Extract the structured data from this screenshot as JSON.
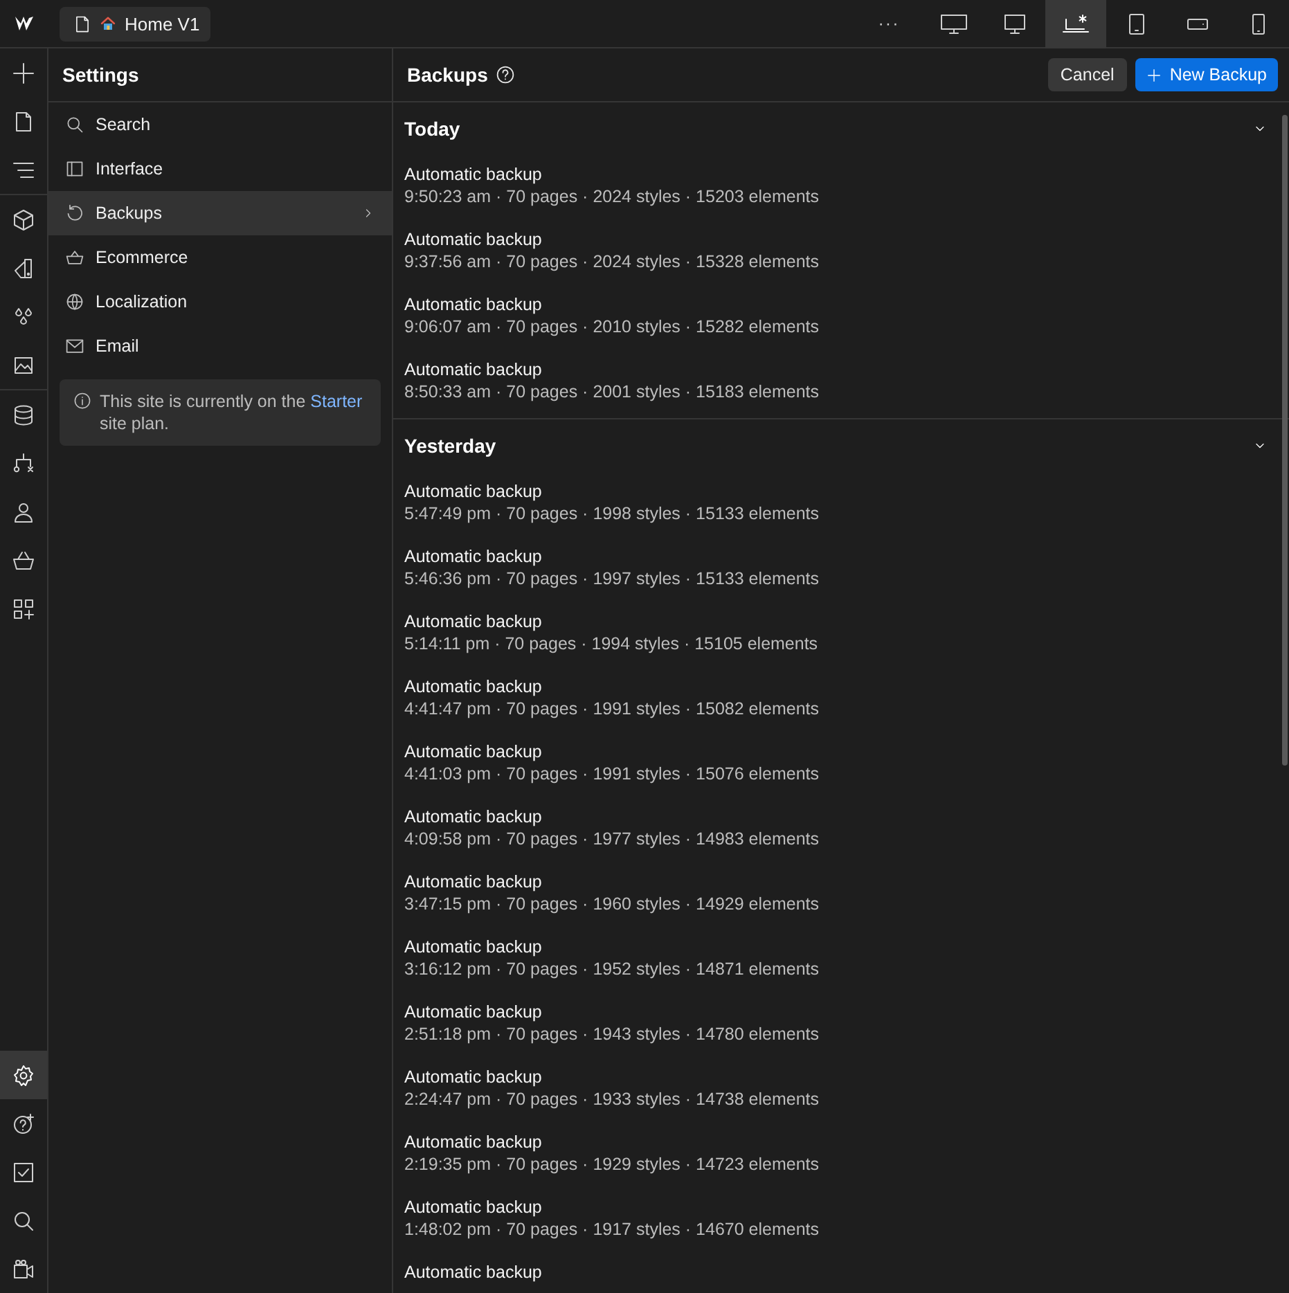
{
  "topbar": {
    "page_button": {
      "label": "Home V1"
    },
    "more": "···",
    "devices": [
      {
        "kind": "desktop-large",
        "selected": false
      },
      {
        "kind": "desktop",
        "selected": false
      },
      {
        "kind": "laptop-star",
        "selected": true
      },
      {
        "kind": "tablet",
        "selected": false
      },
      {
        "kind": "phone-landscape",
        "selected": false
      },
      {
        "kind": "phone",
        "selected": false
      }
    ]
  },
  "rail": {
    "top": [
      {
        "kind": "plus",
        "selected": false
      },
      {
        "kind": "page",
        "selected": false
      },
      {
        "kind": "navigator",
        "selected": false
      },
      {
        "kind": "cube",
        "selected": false
      },
      {
        "kind": "paint",
        "selected": false
      },
      {
        "kind": "drops",
        "selected": false
      },
      {
        "kind": "image",
        "selected": false
      },
      {
        "kind": "database",
        "selected": false
      },
      {
        "kind": "logic",
        "selected": false
      },
      {
        "kind": "user",
        "selected": false
      },
      {
        "kind": "basket",
        "selected": false
      },
      {
        "kind": "apps",
        "selected": false
      }
    ],
    "bottom": [
      {
        "kind": "gear",
        "selected": true
      },
      {
        "kind": "help",
        "selected": false
      },
      {
        "kind": "check",
        "selected": false
      },
      {
        "kind": "search",
        "selected": false
      },
      {
        "kind": "video",
        "selected": false
      }
    ]
  },
  "settings": {
    "title": "Settings",
    "items": [
      {
        "kind": "search",
        "label": "Search",
        "selected": false
      },
      {
        "kind": "interface",
        "label": "Interface",
        "selected": false
      },
      {
        "kind": "backups",
        "label": "Backups",
        "selected": true
      },
      {
        "kind": "ecommerce",
        "label": "Ecommerce",
        "selected": false
      },
      {
        "kind": "localization",
        "label": "Localization",
        "selected": false
      },
      {
        "kind": "email",
        "label": "Email",
        "selected": false
      }
    ],
    "note": {
      "before": "This site is currently on the ",
      "link": "Starter",
      "after": " site plan."
    }
  },
  "backups": {
    "title": "Backups",
    "cancel": "Cancel",
    "new_backup": "New Backup",
    "sections": [
      {
        "title": "Today",
        "expanded": true,
        "rows": [
          {
            "title": "Automatic backup",
            "detail": "9:50:23 am · 70 pages · 2024 styles · 15203 elements"
          },
          {
            "title": "Automatic backup",
            "detail": "9:37:56 am · 70 pages · 2024 styles · 15328 elements"
          },
          {
            "title": "Automatic backup",
            "detail": "9:06:07 am · 70 pages · 2010 styles · 15282 elements"
          },
          {
            "title": "Automatic backup",
            "detail": "8:50:33 am · 70 pages · 2001 styles · 15183 elements"
          }
        ]
      },
      {
        "title": "Yesterday",
        "expanded": true,
        "rows": [
          {
            "title": "Automatic backup",
            "detail": "5:47:49 pm · 70 pages · 1998 styles · 15133 elements"
          },
          {
            "title": "Automatic backup",
            "detail": "5:46:36 pm · 70 pages · 1997 styles · 15133 elements"
          },
          {
            "title": "Automatic backup",
            "detail": "5:14:11 pm · 70 pages · 1994 styles · 15105 elements"
          },
          {
            "title": "Automatic backup",
            "detail": "4:41:47 pm · 70 pages · 1991 styles · 15082 elements"
          },
          {
            "title": "Automatic backup",
            "detail": "4:41:03 pm · 70 pages · 1991 styles · 15076 elements"
          },
          {
            "title": "Automatic backup",
            "detail": "4:09:58 pm · 70 pages · 1977 styles · 14983 elements"
          },
          {
            "title": "Automatic backup",
            "detail": "3:47:15 pm · 70 pages · 1960 styles · 14929 elements"
          },
          {
            "title": "Automatic backup",
            "detail": "3:16:12 pm · 70 pages · 1952 styles · 14871 elements"
          },
          {
            "title": "Automatic backup",
            "detail": "2:51:18 pm · 70 pages · 1943 styles · 14780 elements"
          },
          {
            "title": "Automatic backup",
            "detail": "2:24:47 pm · 70 pages · 1933 styles · 14738 elements"
          },
          {
            "title": "Automatic backup",
            "detail": "2:19:35 pm · 70 pages · 1929 styles · 14723 elements"
          },
          {
            "title": "Automatic backup",
            "detail": "1:48:02 pm · 70 pages · 1917 styles · 14670 elements"
          },
          {
            "title": "Automatic backup"
          }
        ]
      }
    ]
  }
}
